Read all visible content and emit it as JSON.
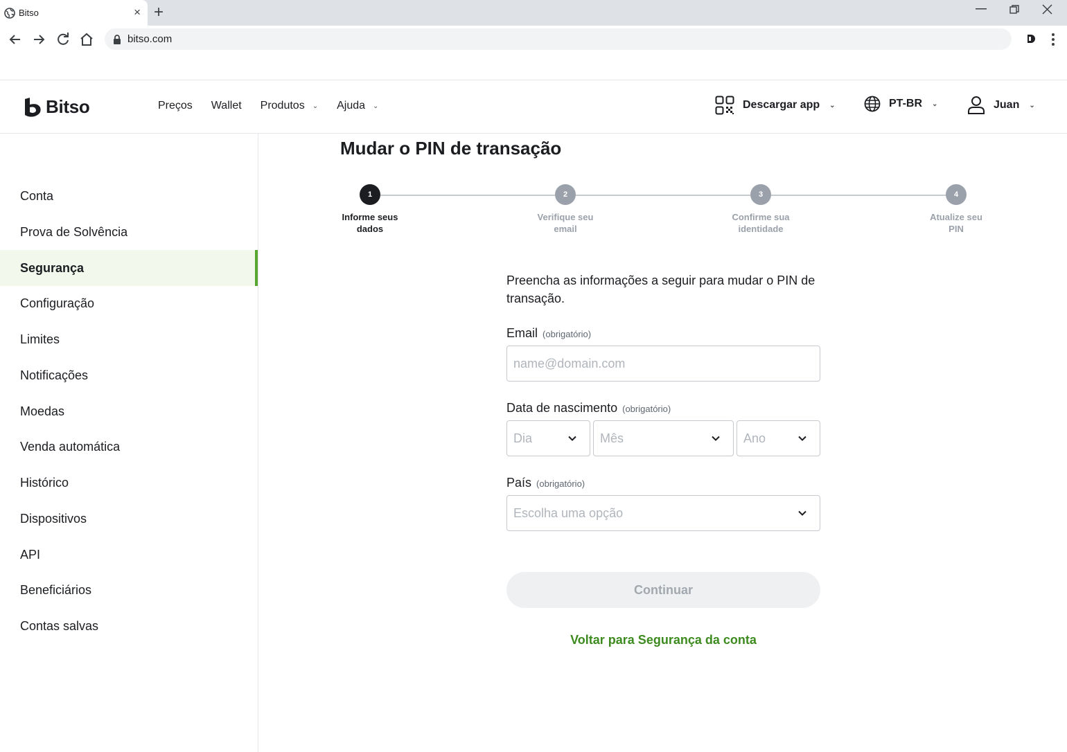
{
  "browser": {
    "tab_title": "Bitso",
    "url": "bitso.com",
    "close_tab": "×",
    "new_tab": "+"
  },
  "header": {
    "brand": "Bitso",
    "nav": [
      {
        "label": "Preços",
        "has_dropdown": false
      },
      {
        "label": "Wallet",
        "has_dropdown": false
      },
      {
        "label": "Produtos",
        "has_dropdown": true
      },
      {
        "label": "Ajuda",
        "has_dropdown": true
      }
    ],
    "download_app": "Descargar app",
    "language": "PT-BR",
    "user": "Juan"
  },
  "sidebar": {
    "items": [
      {
        "label": "Conta",
        "active": false
      },
      {
        "label": "Prova de Solvência",
        "active": false
      },
      {
        "label": "Segurança",
        "active": true
      },
      {
        "label": "Configuração",
        "active": false
      },
      {
        "label": "Limites",
        "active": false
      },
      {
        "label": "Notificações",
        "active": false
      },
      {
        "label": "Moedas",
        "active": false
      },
      {
        "label": "Venda automática",
        "active": false
      },
      {
        "label": "Histórico",
        "active": false
      },
      {
        "label": "Dispositivos",
        "active": false
      },
      {
        "label": "API",
        "active": false
      },
      {
        "label": "Beneficiários",
        "active": false
      },
      {
        "label": "Contas salvas",
        "active": false
      }
    ]
  },
  "main": {
    "title": "Mudar o PIN de transação",
    "steps": [
      {
        "number": "1",
        "label_line1": "Informe seus",
        "label_line2": "dados",
        "active": true
      },
      {
        "number": "2",
        "label_line1": "Verifique seu",
        "label_line2": "email",
        "active": false
      },
      {
        "number": "3",
        "label_line1": "Confirme sua",
        "label_line2": "identidade",
        "active": false
      },
      {
        "number": "4",
        "label_line1": "Atualize seu",
        "label_line2": "PIN",
        "active": false
      }
    ],
    "intro": "Preencha as informações a seguir para mudar o PIN de transação.",
    "email": {
      "label": "Email",
      "required": "(obrigatório)",
      "placeholder": "name@domain.com"
    },
    "birth": {
      "label": "Data de nascimento",
      "required": "(obrigatório)",
      "day": "Dia",
      "month": "Mês",
      "year": "Ano"
    },
    "country": {
      "label": "País",
      "required": "(obrigatório)",
      "placeholder": "Escolha uma opção"
    },
    "continue": "Continuar",
    "back_link": "Voltar para Segurança da conta"
  },
  "colors": {
    "accent": "#56a62f",
    "link": "#3d8b1e",
    "active_bg": "#f2f8ec"
  }
}
